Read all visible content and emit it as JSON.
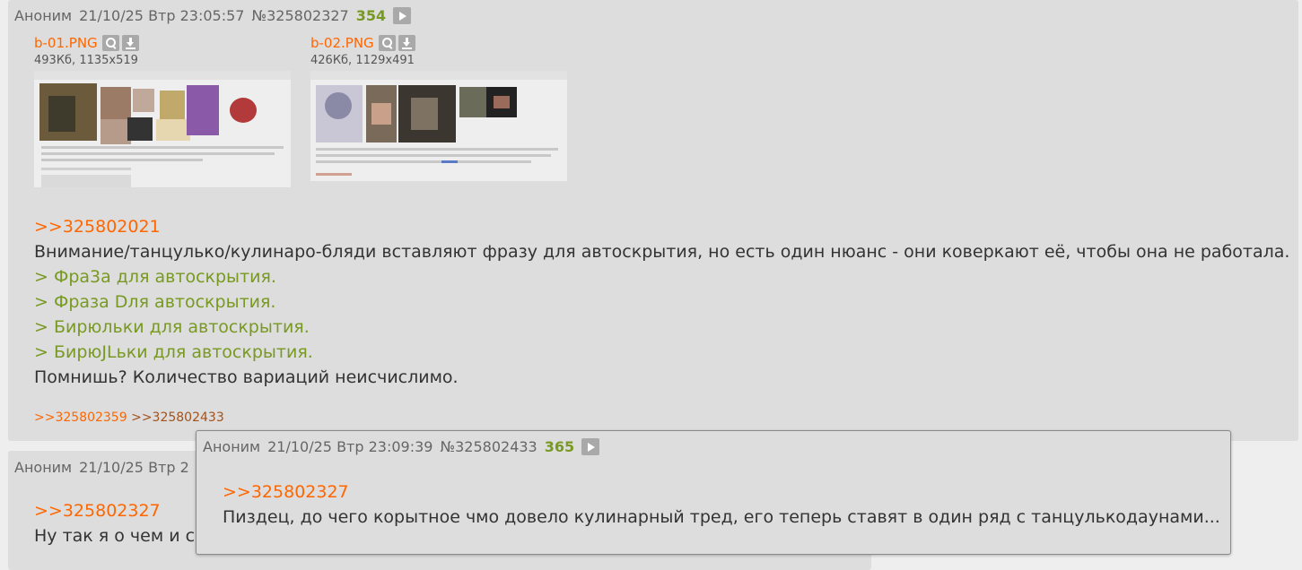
{
  "post1": {
    "author": "Аноним",
    "datetime": "21/10/25 Втр 23:05:57",
    "number": "№325802327",
    "count": "354",
    "files": [
      {
        "name": "b-01.PNG",
        "meta": "493Кб, 1135x519"
      },
      {
        "name": "b-02.PNG",
        "meta": "426Кб, 1129x491"
      }
    ],
    "reply_link": ">>325802021",
    "lines": [
      "Внимание/танцулько/кулинаро-бляди вставляют фразу для автоскрытия, но есть один нюанс - они коверкают её, чтобы она не работала.",
      "> Фра3а для автоскрытия.",
      "> Фраза Dля автоскрытия.",
      "> Бирюльки для автоскрытия.",
      "> БирюJLьки для автоскрытия.",
      "Помнишь? Количество вариаций неисчислимо."
    ],
    "backlinks": [
      ">>325802359",
      ">>325802433"
    ]
  },
  "post2": {
    "author": "Аноним",
    "datetime_partial": "21/10/25 Втр 2",
    "reply_link": ">>325802327",
    "text_partial": "Ну так я о чем и с"
  },
  "popup": {
    "author": "Аноним",
    "datetime": "21/10/25 Втр 23:09:39",
    "number": "№325802433",
    "count": "365",
    "reply_link": ">>325802327",
    "text": "Пиздец, до чего корытное чмо довело кулинарный тред, его теперь ставят в один ряд с танцулькодаунами..."
  },
  "colors": {
    "background": "#eeeeee",
    "post_bg": "#dddddd",
    "link": "#ff6600",
    "greentext": "#789922",
    "text": "#333333",
    "header": "#666666"
  },
  "icons": [
    "play-icon",
    "search-icon",
    "download-icon"
  ]
}
